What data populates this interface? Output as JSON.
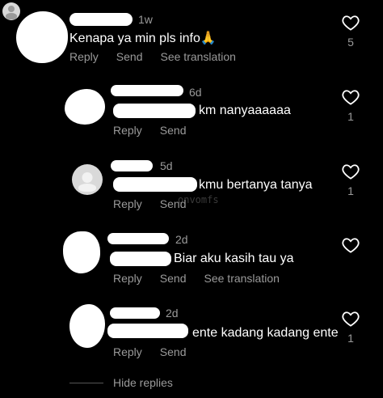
{
  "comments": [
    {
      "time": "1w",
      "text": "Kenapa ya min pls info🙏",
      "actions": [
        "Reply",
        "Send",
        "See translation"
      ],
      "like_count": "5"
    },
    {
      "time": "6d",
      "text": "km nanyaaaaaa",
      "actions": [
        "Reply",
        "Send"
      ],
      "like_count": "1"
    },
    {
      "time": "5d",
      "text": "kmu bertanya tanya",
      "actions": [
        "Reply",
        "Send"
      ],
      "like_count": "1"
    },
    {
      "time": "2d",
      "text": "Biar aku kasih tau ya",
      "actions": [
        "Reply",
        "Send",
        "See translation"
      ],
      "like_count": ""
    },
    {
      "time": "2d",
      "text": "ente kadang kadang ente",
      "actions": [
        "Reply",
        "Send"
      ],
      "like_count": "1"
    }
  ],
  "watermark": "onvomfs",
  "hide_replies": "Hide replies",
  "icons": {
    "like": "heart-outline-icon",
    "avatar_default": "default-avatar-icon"
  },
  "colors": {
    "background": "#000000",
    "text": "#ffffff",
    "muted": "#9a9a9a"
  }
}
